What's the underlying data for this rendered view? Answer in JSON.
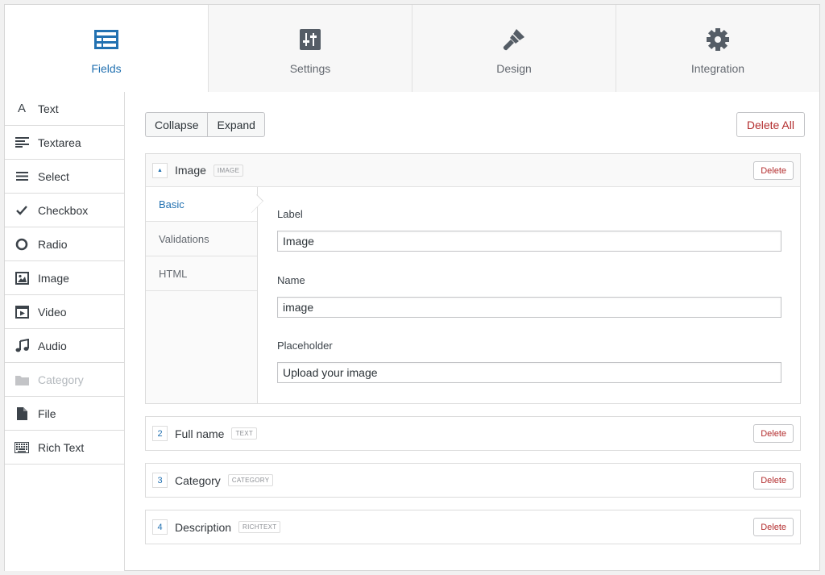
{
  "tabs": [
    {
      "label": "Fields",
      "icon": "fields-icon",
      "active": true
    },
    {
      "label": "Settings",
      "icon": "sliders-icon"
    },
    {
      "label": "Design",
      "icon": "brush-icon"
    },
    {
      "label": "Integration",
      "icon": "gear-icon"
    }
  ],
  "sidebar": {
    "items": [
      {
        "label": "Text",
        "icon": "text-icon"
      },
      {
        "label": "Textarea",
        "icon": "textarea-icon"
      },
      {
        "label": "Select",
        "icon": "select-icon"
      },
      {
        "label": "Checkbox",
        "icon": "checkbox-icon"
      },
      {
        "label": "Radio",
        "icon": "radio-icon"
      },
      {
        "label": "Image",
        "icon": "image-icon"
      },
      {
        "label": "Video",
        "icon": "video-icon"
      },
      {
        "label": "Audio",
        "icon": "audio-icon"
      },
      {
        "label": "Category",
        "icon": "folder-icon",
        "disabled": true
      },
      {
        "label": "File",
        "icon": "file-icon"
      },
      {
        "label": "Rich Text",
        "icon": "keyboard-icon"
      }
    ]
  },
  "toolbar": {
    "collapse_label": "Collapse",
    "expand_label": "Expand",
    "delete_all_label": "Delete All"
  },
  "fields": [
    {
      "number": "",
      "title": "Image",
      "type": "IMAGE",
      "delete_label": "Delete",
      "open": true
    },
    {
      "number": "2",
      "title": "Full name",
      "type": "TEXT",
      "delete_label": "Delete"
    },
    {
      "number": "3",
      "title": "Category",
      "type": "CATEGORY",
      "delete_label": "Delete"
    },
    {
      "number": "4",
      "title": "Description",
      "type": "RICHTEXT",
      "delete_label": "Delete"
    }
  ],
  "editor": {
    "tabs": [
      {
        "label": "Basic",
        "active": true
      },
      {
        "label": "Validations"
      },
      {
        "label": "HTML"
      }
    ],
    "label_caption": "Label",
    "label_value": "Image",
    "name_caption": "Name",
    "name_value": "image",
    "placeholder_caption": "Placeholder",
    "placeholder_value": "Upload your image"
  },
  "colors": {
    "accent": "#2271b1",
    "danger": "#b32d2e",
    "icon": "#555d66"
  }
}
